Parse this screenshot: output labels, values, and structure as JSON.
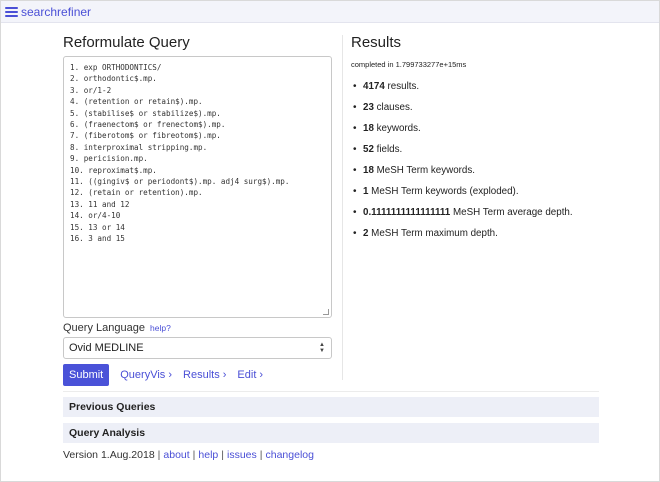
{
  "navbar": {
    "brand": "searchrefiner"
  },
  "reformulate": {
    "title": "Reformulate Query",
    "lines": [
      "1. exp ORTHODONTICS/",
      "2. orthodontic$.mp.",
      "3. or/1-2",
      "4. (retention or retain$).mp.",
      "5. (stabilise$ or stabilize$).mp.",
      "6. (fraenectom$ or frenectom$).mp.",
      "7. (fiberotom$ or fibreotom$).mp.",
      "8. interproximal stripping.mp.",
      "9. pericision.mp.",
      "10. reproximat$.mp.",
      "11. ((gingiv$ or periodont$).mp. adj4 surg$).mp.",
      "12. (retain or retention).mp.",
      "13. 11 and 12",
      "14. or/4-10",
      "15. 13 or 14",
      "16. 3 and 15"
    ],
    "language_label": "Query Language",
    "language_help": "help?",
    "language_value": "Ovid MEDLINE",
    "submit_label": "Submit",
    "links": [
      "QueryVis ›",
      "Results ›",
      "Edit ›"
    ]
  },
  "results": {
    "title": "Results",
    "completed": "completed in 1.799733277e+15ms",
    "items": [
      {
        "value": "4174",
        "text": " results."
      },
      {
        "value": "23",
        "text": " clauses."
      },
      {
        "value": "18",
        "text": " keywords."
      },
      {
        "value": "52",
        "text": " fields."
      },
      {
        "value": "18",
        "text": " MeSH Term keywords."
      },
      {
        "value": "1",
        "text": " MeSH Term keywords (exploded)."
      },
      {
        "value": "0.1111111111111111",
        "text": " MeSH Term average depth."
      },
      {
        "value": "2",
        "text": " MeSH Term maximum depth."
      }
    ]
  },
  "panels": {
    "previous": "Previous Queries",
    "analysis": "Query Analysis"
  },
  "footer": {
    "version": "Version 1.Aug.2018",
    "links": [
      "about",
      "help",
      "issues",
      "changelog"
    ]
  },
  "colors": {
    "accent": "#4a4fd6",
    "submit_bg": "#4a52d8",
    "panel_bg": "#edeff7",
    "navbar_bg": "#f3f4fa"
  },
  "icons": {
    "menu": "hamburger-menu-icon",
    "select": "select-arrows-icon",
    "resize": "resize-grip-icon"
  }
}
